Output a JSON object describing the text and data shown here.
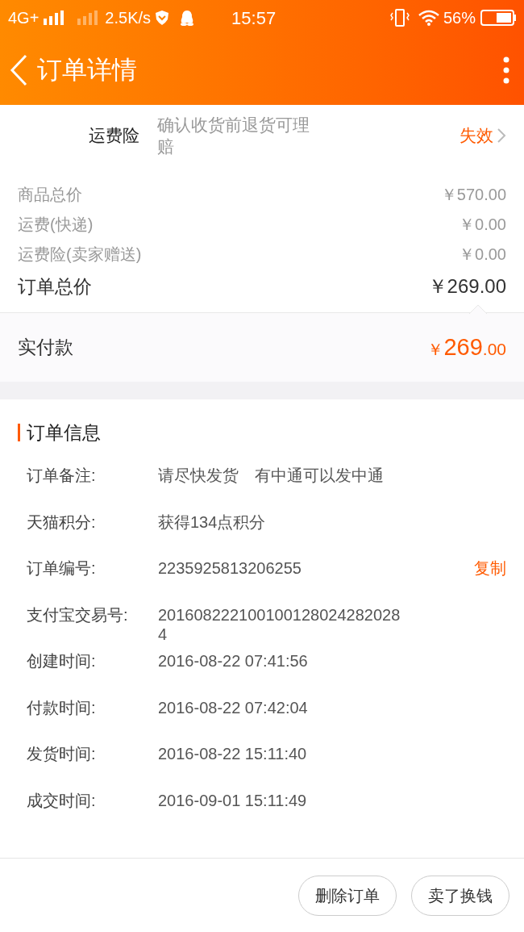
{
  "status_bar": {
    "network": "4G+",
    "speed": "2.5K/s",
    "time": "15:57",
    "battery": "56%"
  },
  "header": {
    "title": "订单详情"
  },
  "insurance": {
    "label": "运费险",
    "description": "确认收货前退货可理赔",
    "status": "失效"
  },
  "price_lines": [
    {
      "label": "商品总价",
      "value": "￥570.00"
    },
    {
      "label": "运费(快递)",
      "value": "￥0.00"
    },
    {
      "label": "运费险(卖家赠送)",
      "value": "￥0.00"
    }
  ],
  "order_total": {
    "label": "订单总价",
    "value": "￥269.00"
  },
  "paid": {
    "label": "实付款",
    "currency": "￥",
    "amount": "269",
    "decimals": ".00"
  },
  "order_info": {
    "title": "订单信息",
    "rows": [
      {
        "label": "订单备注:",
        "value": "请尽快发货　有中通可以发中通"
      },
      {
        "label": "天猫积分:",
        "value": "获得134点积分"
      },
      {
        "label": "订单编号:",
        "value": "2235925813206255",
        "action": "复制"
      },
      {
        "label": "支付宝交易号:",
        "value": "2016082221001001280242820284"
      },
      {
        "label": "创建时间:",
        "value": "2016-08-22 07:41:56"
      },
      {
        "label": "付款时间:",
        "value": "2016-08-22 07:42:04"
      },
      {
        "label": "发货时间:",
        "value": "2016-08-22 15:11:40"
      },
      {
        "label": "成交时间:",
        "value": "2016-09-01 15:11:49"
      }
    ]
  },
  "buttons": [
    "删除订单",
    "卖了换钱"
  ]
}
